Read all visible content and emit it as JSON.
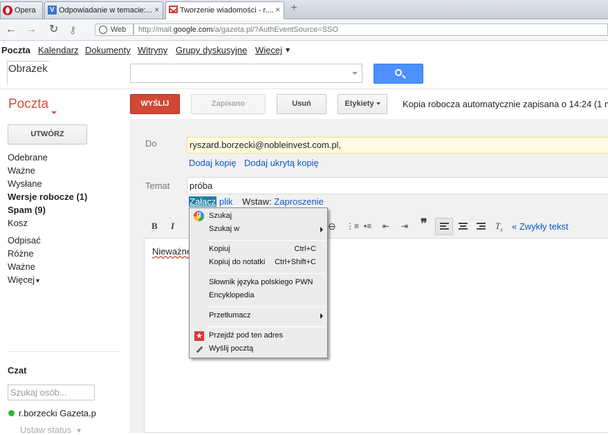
{
  "browser": {
    "tabs": [
      {
        "label": "Opera"
      },
      {
        "label": "Odpowiadanie w temacie:...",
        "close": "×"
      },
      {
        "label": "Tworzenie wiadomości - r....",
        "close": "×"
      }
    ],
    "new_tab": "+",
    "web_chip": "Web",
    "url": {
      "prefix": "http://mail.",
      "domain": "google.com",
      "suffix": "/a/gazeta.pl/?AuthEventSource=SSO"
    }
  },
  "gbar": {
    "items": [
      "Poczta",
      "Kalendarz",
      "Dokumenty",
      "Witryny",
      "Grupy dyskusyjne",
      "Więcej"
    ],
    "more_arrow": "▾"
  },
  "header": {
    "logo_text": "Obrazek",
    "search_value": ""
  },
  "app": {
    "title": "Poczta"
  },
  "toolbar": {
    "send": "WYŚLIJ",
    "saved": "Zapisano",
    "delete": "Usuń",
    "labels": "Etykiety",
    "autosave": "Kopia robocza automatycznie zapisana o 14:24 (1 m"
  },
  "sidebar": {
    "compose": "UTWÓRZ",
    "items": [
      "Odebrane",
      "Ważne",
      "Wysłane",
      "Wersje robocze (1)",
      "Spam (9)",
      "Kosz",
      "Odpisać",
      "Różne",
      "Ważne",
      "Więcej"
    ],
    "more_arrow": "▾"
  },
  "chat": {
    "title": "Czat",
    "search_placeholder": "Szukaj osób...",
    "user": "r.borzecki Gazeta.p",
    "status": "Ustaw status",
    "status_arrow": "▾"
  },
  "compose": {
    "to_label": "Do",
    "to_value": "ryszard.borzecki@nobleinvest.com.pl,",
    "add_cc": "Dodaj kopię",
    "add_bcc": "Dodaj ukrytą kopię",
    "subject_label": "Temat",
    "subject_value": "próba",
    "attach_highlight": "Załącz",
    "attach_rest": " plik",
    "insert_label": "Wstaw:",
    "insert_link": "Zaproszenie",
    "format": {
      "bold": "B",
      "italic": "I",
      "plain_text": "« Zwykły tekst"
    },
    "body": "Nieważne"
  },
  "context_menu": {
    "items": [
      {
        "label": "Szukaj"
      },
      {
        "label": "Szukaj w"
      },
      {
        "label": "Kopiuj",
        "shortcut": "Ctrl+C"
      },
      {
        "label": "Kopiuj do notatki",
        "shortcut": "Ctrl+Shift+C"
      },
      {
        "label": "Słownik języka polskiego PWN"
      },
      {
        "label": "Encyklopedia"
      },
      {
        "label": "Przetłumacz"
      },
      {
        "label": "Przejdź pod ten adres"
      },
      {
        "label": "Wyślij pocztą"
      }
    ],
    "star_glyph": "★"
  },
  "colors": {
    "accent_red": "#d14836",
    "link_blue": "#1155cc",
    "search_blue": "#4d90fe",
    "online_green": "#2eb82e"
  }
}
